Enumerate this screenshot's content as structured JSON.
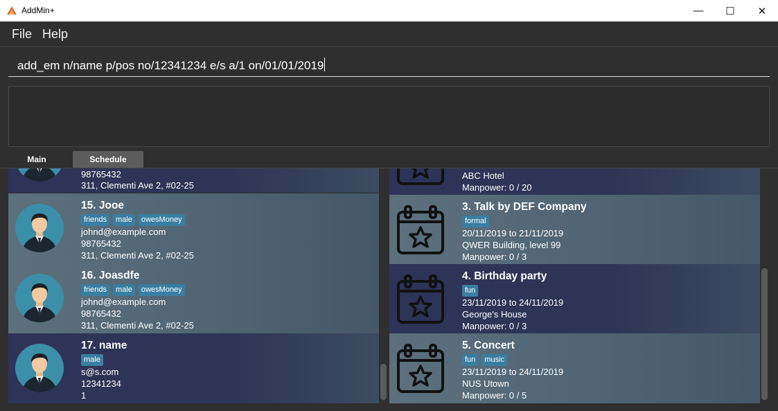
{
  "window": {
    "title": "AddMin+",
    "minimize": "—",
    "maximize": "☐",
    "close": "✕"
  },
  "menu": {
    "file": "File",
    "help": "Help"
  },
  "command": {
    "value": "add_em n/name p/pos no/12341234 e/s a/1 on/01/01/2019"
  },
  "tabs": {
    "main": "Main",
    "schedule": "Schedule"
  },
  "employees": {
    "partial": {
      "phone": "98765432",
      "address": "311, Clementi Ave 2, #02-25"
    },
    "items": [
      {
        "title": "15.  Jooe",
        "tags": [
          "friends",
          "male",
          "owesMoney"
        ],
        "email": "johnd@example.com",
        "phone": "98765432",
        "address": "311, Clementi Ave 2, #02-25"
      },
      {
        "title": "16.  Joasdfe",
        "tags": [
          "friends",
          "male",
          "owesMoney"
        ],
        "email": "johnd@example.com",
        "phone": "98765432",
        "address": "311, Clementi Ave 2, #02-25"
      },
      {
        "title": "17.  name",
        "tags": [
          "male"
        ],
        "email": "s@s.com",
        "phone": "12341234",
        "address": "1"
      }
    ]
  },
  "events": {
    "partial": {
      "venue": "ABC Hotel",
      "manpower": "Manpower: 0 / 20"
    },
    "items": [
      {
        "title": "3.  Talk by DEF Company",
        "tags": [
          "formal"
        ],
        "dates": "20/11/2019 to 21/11/2019",
        "venue": "QWER Building, level 99",
        "manpower": "Manpower: 0 / 3"
      },
      {
        "title": "4.  Birthday party",
        "tags": [
          "fun"
        ],
        "dates": "23/11/2019 to 24/11/2019",
        "venue": "George's House",
        "manpower": "Manpower: 0 / 3"
      },
      {
        "title": "5.  Concert",
        "tags": [
          "fun",
          "music"
        ],
        "dates": "23/11/2019 to 24/11/2019",
        "venue": "NUS Utown",
        "manpower": "Manpower: 0 / 5"
      }
    ]
  }
}
